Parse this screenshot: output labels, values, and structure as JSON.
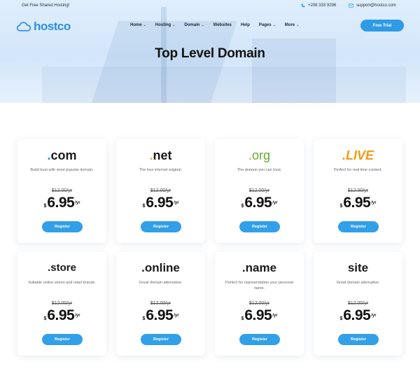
{
  "topbar": {
    "promo": "Get Free Shared Hosting!",
    "phone": "+208 333 9296",
    "email": "support@hostco.com"
  },
  "logo": {
    "text": "hostco"
  },
  "nav": {
    "items": [
      {
        "label": "Home",
        "caret": true
      },
      {
        "label": "Hosting",
        "caret": true
      },
      {
        "label": "Domain",
        "caret": true
      },
      {
        "label": "Websites",
        "caret": false
      },
      {
        "label": "Help",
        "caret": false
      },
      {
        "label": "Pages",
        "caret": true
      },
      {
        "label": "More",
        "caret": true
      }
    ],
    "cta": "Free Trial"
  },
  "page_title": "Top Level Domain",
  "colors": {
    "accent": "#2e9be6",
    "com_dot": "#1e90e0",
    "net_dot": "#f2b01e",
    "org": "#6aaa2a",
    "live": "#f29a12"
  },
  "domains": [
    {
      "tld": ".com",
      "desc": "Build trust with most popular domain.",
      "old_price": "$12.00/yr",
      "currency": "$",
      "price": "6.95",
      "per": "/yr",
      "button": "Register"
    },
    {
      "tld": ".net",
      "desc": "The true internet original.",
      "old_price": "$12.00/yr",
      "currency": "$",
      "price": "6.95",
      "per": "/yr",
      "button": "Register"
    },
    {
      "tld": ".org",
      "desc": "The domain you can trust.",
      "old_price": "$12.00/yr",
      "currency": "$",
      "price": "6.95",
      "per": "/yr",
      "button": "Register"
    },
    {
      "tld": ".LIVE",
      "desc": "Perfect for real time content.",
      "old_price": "$12.00/yr",
      "currency": "$",
      "price": "6.95",
      "per": "/yr",
      "button": "Register"
    },
    {
      "tld": ".store",
      "desc": "Suitable online stores and retail brands.",
      "old_price": "$12.00/yr",
      "currency": "$",
      "price": "6.95",
      "per": "/yr",
      "button": "Register"
    },
    {
      "tld": ".online",
      "desc": "Great domain alternative.",
      "old_price": "$12.00/yr",
      "currency": "$",
      "price": "6.95",
      "per": "/yr",
      "button": "Register"
    },
    {
      "tld": ".name",
      "desc": "Perfect for representation your personal name.",
      "old_price": "$12.00/yr",
      "currency": "$",
      "price": "6.95",
      "per": "/yr",
      "button": "Register"
    },
    {
      "tld": "site",
      "desc": "Great domain alternative.",
      "old_price": "$12.00/yr",
      "currency": "$",
      "price": "6.95",
      "per": "/yr",
      "button": "Register"
    }
  ]
}
